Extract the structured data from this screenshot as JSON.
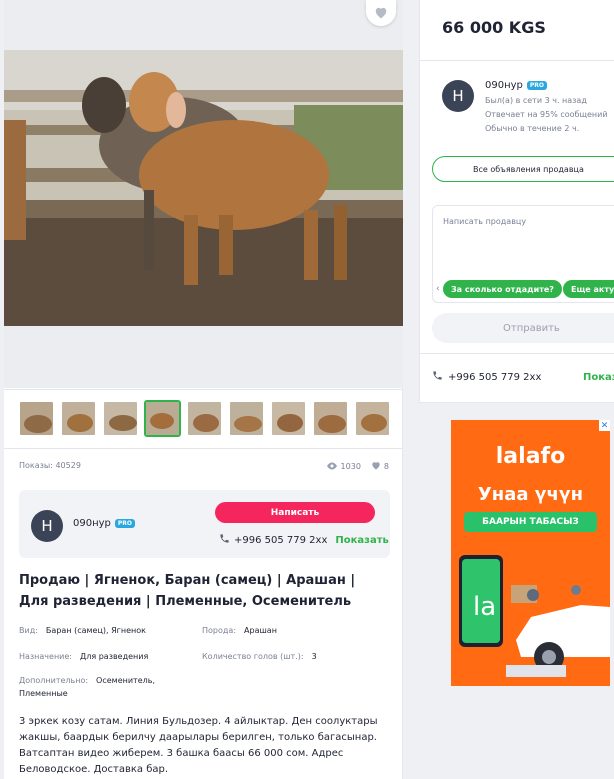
{
  "listing": {
    "views_label": "Показы: 40529",
    "views_count": "1030",
    "favorites_count": "8",
    "thumbnail_count": 9,
    "active_thumbnail": 4,
    "title": "Продаю | Ягненок, Баран (самец) | Арашан | Для разведения | Племенные, Осеменитель",
    "attributes": [
      {
        "key": "Вид:",
        "value": "Баран (самец), Ягненок"
      },
      {
        "key": "Порода:",
        "value": "Арашан"
      },
      {
        "key": "Назначение:",
        "value": "Для разведения"
      },
      {
        "key": "Количество голов (шт.):",
        "value": "3"
      },
      {
        "key": "Дополнительно:",
        "value": "Осеменитель,"
      },
      {
        "key": "",
        "value": "Племенные"
      }
    ],
    "description": "3 эркек козу сатам. Линия Бульдозер. 4 айлыктар. Ден соолуктары жакшы, баардык берилчу даарылары берилген, только багасынар. Ватсаптан видео жиберем. 3 башка баасы 66 000 сом. Адрес Беловодское. Доставка бар."
  },
  "seller": {
    "initial": "Н",
    "name": "090нур",
    "badge": "PRO",
    "write_label": "Написать",
    "phone": "+996 505 779 2xx",
    "show_label": "Показать",
    "last_seen": "Был(а) в сети 3 ч. назад",
    "response_rate": "Отвечает на 95% сообщений",
    "response_time": "Обычно в течение 2 ч.",
    "all_ads_label": "Все объявления продавца"
  },
  "sidebar": {
    "price": "66 000 KGS",
    "message_placeholder": "Написать продавцу",
    "quick_replies": [
      "За сколько отдадите?",
      "Еще актуально?"
    ],
    "send_label": "Отправить",
    "show_label": "Показ"
  },
  "ad": {
    "logo": "lalafo",
    "headline": "Унаа үчүн",
    "pill": "БААРЫН ТАБАСЫЗ",
    "close": "✕"
  },
  "colors": {
    "accent_green": "#2fb34a",
    "write_pink": "#f5265e",
    "pro_blue": "#2aa7e0",
    "ad_orange": "#ff6a13"
  },
  "icons": [
    "heart-icon",
    "eye-icon",
    "phone-icon",
    "chevron-left-icon",
    "close-icon"
  ]
}
